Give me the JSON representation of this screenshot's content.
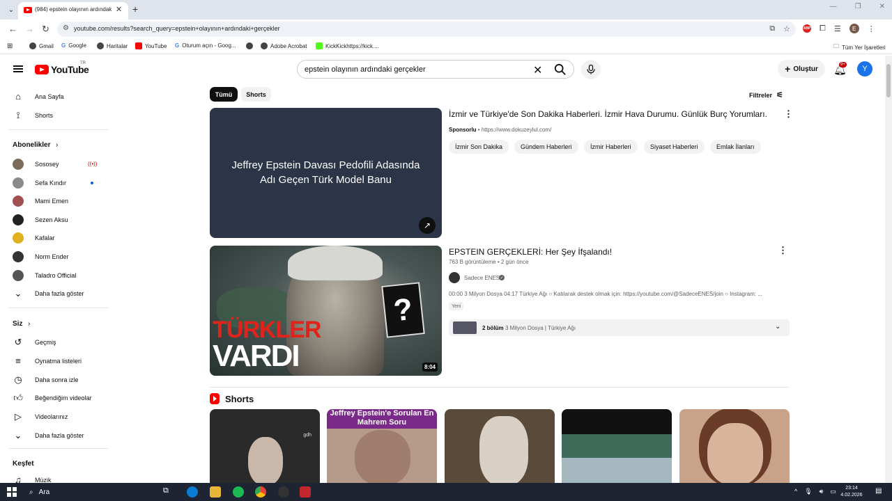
{
  "browser": {
    "tab_title": "(984) epstein olayının ardındaki",
    "url": "youtube.com/results?search_query=epstein+olayının+ardındaki+gerçekler",
    "bookmarks": [
      "Gmail",
      "Google",
      "Haritalar",
      "YouTube",
      "Oturum açın - Goog...",
      "",
      "Adobe Acrobat",
      "KickKickhttps://kick...."
    ],
    "all_bookmarks": "Tüm Yer İşaretleri",
    "abp_label": "ABP",
    "profile_letter": "E"
  },
  "header": {
    "logo_text": "YouTube",
    "country": "TR",
    "search_value": "epstein olayının ardındaki gerçekler",
    "create_label": "Oluştur",
    "notifications": "9+",
    "avatar_letter": "Y"
  },
  "sidebar": {
    "main": [
      {
        "label": "Ana Sayfa",
        "icon": "home-icon"
      },
      {
        "label": "Shorts",
        "icon": "shorts-icon"
      }
    ],
    "subs_title": "Abonelikler",
    "subscriptions": [
      {
        "label": "Sososey",
        "color": "#7a6b5a"
      },
      {
        "label": "Sefa Kındır",
        "color": "#8a8a8a"
      },
      {
        "label": "Mami Emen",
        "color": "#a05050"
      },
      {
        "label": "Sezen Aksu",
        "color": "#222222"
      },
      {
        "label": "Kafalar",
        "color": "#e0b020"
      },
      {
        "label": "Norm Ender",
        "color": "#333333"
      },
      {
        "label": "Taladro Official",
        "color": "#555555"
      }
    ],
    "show_more": "Daha fazla göster",
    "you_title": "Siz",
    "you_items": [
      {
        "label": "Geçmiş",
        "icon": "history-icon"
      },
      {
        "label": "Oynatma listeleri",
        "icon": "playlist-icon"
      },
      {
        "label": "Daha sonra izle",
        "icon": "clock-icon"
      },
      {
        "label": "Beğendiğim videolar",
        "icon": "like-icon"
      },
      {
        "label": "Videolarınız",
        "icon": "video-icon"
      }
    ],
    "show_more_2": "Daha fazla göster",
    "explore_title": "Keşfet",
    "explore_items": [
      {
        "label": "Müzik",
        "icon": "music-icon"
      }
    ]
  },
  "chips": {
    "all": "Tümü",
    "shorts": "Shorts",
    "filters": "Filtreler"
  },
  "ad": {
    "thumb_text": "Jeffrey Epstein Davası Pedofili Adasında Adı Geçen Türk Model Banu",
    "title": "İzmir ve Türkiye'de Son Dakika Haberleri. İzmir Hava Durumu. Günlük Burç Yorumları.",
    "sponsored": "Sponsorlu",
    "url": "https://www.dokuzeylul.com/",
    "chips": [
      "İzmir Son Dakika",
      "Gündem Haberleri",
      "İzmir Haberleri",
      "Siyaset Haberleri",
      "Emlak İlanları"
    ]
  },
  "video": {
    "overlay_line1": "TÜRKLER",
    "overlay_line2": "VARDI",
    "duration": "8:04",
    "title": "EPSTEIN GERÇEKLERİ: Her Şey İfşalandı!",
    "views": "763 B görüntüleme",
    "age": "2 gün önce",
    "channel": "Sadece ENES",
    "description": "00:00 3 Milyon Dosya 04:17 Türkiye Ağı ○ Katılarak destek olmak için: https://youtube.com/@SadeceENES/join ○ Instagram: ...",
    "badge": "Yeni",
    "chapter_count": "2 bölüm",
    "chapter_text": "3 Milyon Dosya | Türkiye Ağı"
  },
  "shorts": {
    "title": "Shorts",
    "items": [
      {
        "color": "#2a2a2a",
        "overlay": "gdh"
      },
      {
        "color": "#b79b8a",
        "overlay": "Jeffrey Epstein'e Sorulan En Mahrem Soru"
      },
      {
        "color": "#5a4a3a",
        "overlay": ""
      },
      {
        "color": "#3e6b5a",
        "overlay": ""
      },
      {
        "color": "#c9a28a",
        "overlay": ""
      }
    ]
  },
  "taskbar": {
    "search": "Ara",
    "time": "23:14",
    "date": "4.02.2026"
  }
}
